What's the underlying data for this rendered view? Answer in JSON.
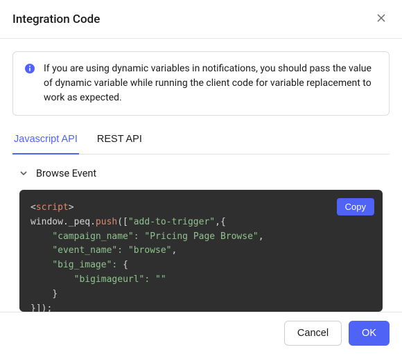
{
  "header": {
    "title": "Integration Code"
  },
  "info": {
    "text": "If you are using dynamic variables in notifications, you should pass the value of dynamic variable while running the client code for variable replacement to work as expected."
  },
  "tabs": {
    "items": [
      {
        "label": "Javascript API",
        "active": true
      },
      {
        "label": "REST API",
        "active": false
      }
    ]
  },
  "accordion": {
    "title": "Browse Event"
  },
  "code": {
    "copy_label": "Copy",
    "tokens": {
      "lt": "<",
      "gt": ">",
      "script_tag": "script",
      "window_peq": "window._peq",
      "dot": ".",
      "push": "push",
      "open": "([",
      "close_obj": "}",
      "close_all": "}]);",
      "comma_open_obj": ",{",
      "comma": ",",
      "add_to_trigger": "\"add-to-trigger\"",
      "campaign_name_key": "\"campaign_name\":",
      "campaign_name_val": "\"Pricing Page Browse\"",
      "event_name_key": "\"event_name\":",
      "event_name_val": "\"browse\"",
      "big_image_key": "\"big_image\":",
      "open_obj": "{",
      "bigimageurl_key": "\"bigimageurl\":",
      "bigimageurl_val": "\"\""
    }
  },
  "footer": {
    "cancel": "Cancel",
    "ok": "OK"
  }
}
